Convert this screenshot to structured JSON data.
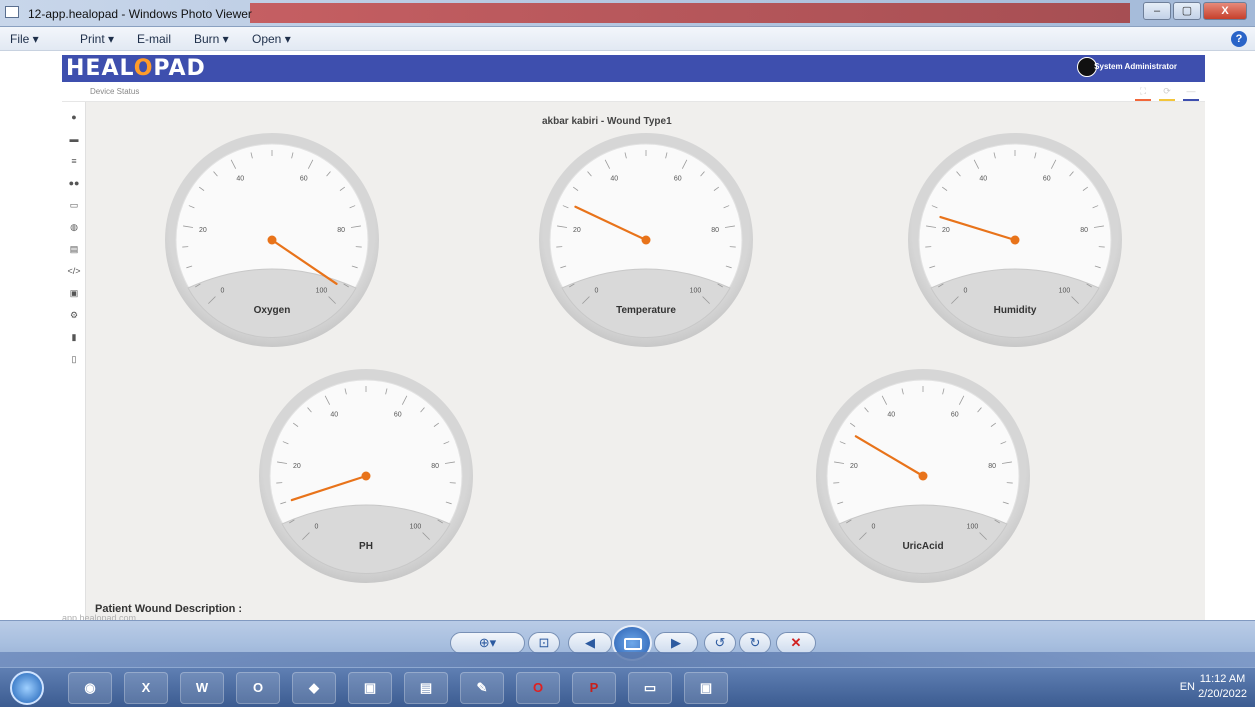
{
  "window": {
    "title": "12-app.healopad - Windows Photo Viewer",
    "minimize": "–",
    "maximize": "▢",
    "close": "X"
  },
  "menu": {
    "file": "File ▾",
    "print": "Print ▾",
    "email": "E-mail",
    "burn": "Burn ▾",
    "open": "Open ▾",
    "help": "?"
  },
  "app": {
    "logo_a": "HEAL",
    "logo_o": "O",
    "logo_b": "PAD",
    "user": "System Administrator",
    "breadcrumb": "Device Status",
    "patient_title": "akbar kabiri - Wound Type1",
    "description_label": "Patient Wound Description :",
    "url_hint": "app.healopad.com",
    "accent_colors": [
      "#f2673a",
      "#f3c53a",
      "#3e4fae"
    ]
  },
  "gauges": [
    {
      "label": "Oxygen",
      "value": 96
    },
    {
      "label": "Temperature",
      "value": 26
    },
    {
      "label": "Humidity",
      "value": 23
    },
    {
      "label": "PH",
      "value": 10
    },
    {
      "label": "UricAcid",
      "value": 28
    }
  ],
  "gauge_scale": {
    "min": 0,
    "max": 100,
    "ticks": [
      "0",
      "20",
      "40",
      "60",
      "80",
      "100"
    ],
    "needle_color": "#e8731a"
  },
  "viewer": {
    "zoom": "⊕▾",
    "fit": "⊡",
    "prev": "◀",
    "next": "▶",
    "rotate_left": "↺",
    "rotate_right": "↻",
    "delete": "✕"
  },
  "taskbar": {
    "apps": [
      "chrome-icon",
      "excel-icon",
      "word-icon",
      "outlook-icon",
      "photos-icon",
      "teams-icon",
      "computer-icon",
      "pen-icon",
      "opera-icon",
      "powerpoint-p-icon",
      "folder-icon",
      "photo-viewer-icon"
    ],
    "tray_text": "EN",
    "time": "11:12 AM",
    "date": "2/20/2022"
  }
}
